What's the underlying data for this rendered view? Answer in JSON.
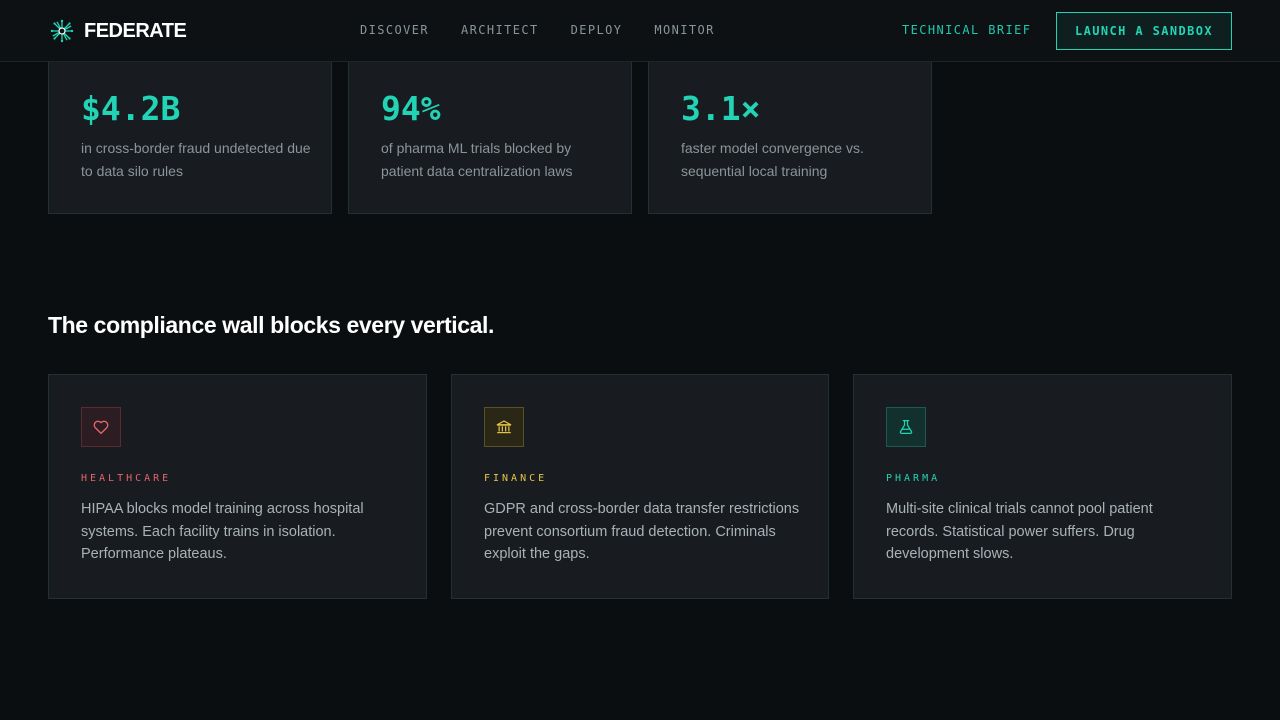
{
  "brand": {
    "name": "FEDERATE",
    "logo_icon": "radial-network-icon",
    "accent": "#22d3b5"
  },
  "nav": {
    "links": [
      "DISCOVER",
      "ARCHITECT",
      "DEPLOY",
      "MONITOR"
    ],
    "brief_label": "TECHNICAL BRIEF",
    "cta_label": "LAUNCH A SANDBOX"
  },
  "stats": [
    {
      "value": "$4.2B",
      "description": "in cross-border fraud undetected due to data silo rules"
    },
    {
      "value": "94%",
      "description": "of pharma ML trials blocked by patient data centralization laws"
    },
    {
      "value": "3.1×",
      "description": "faster model convergence vs. sequential local training"
    }
  ],
  "section": {
    "title": "The compliance wall blocks every vertical."
  },
  "verticals": [
    {
      "icon": "heart-icon",
      "label": "HEALTHCARE",
      "color": "#e5646a",
      "text": "HIPAA blocks model training across hospital systems. Each facility trains in isolation. Performance plateaus."
    },
    {
      "icon": "bank-icon",
      "label": "FINANCE",
      "color": "#e8c547",
      "text": "GDPR and cross-border data transfer restrictions prevent consortium fraud detection. Criminals exploit the gaps."
    },
    {
      "icon": "flask-icon",
      "label": "PHARMA",
      "color": "#22d3b5",
      "text": "Multi-site clinical trials cannot pool patient records. Statistical power suffers. Drug development slows."
    }
  ]
}
